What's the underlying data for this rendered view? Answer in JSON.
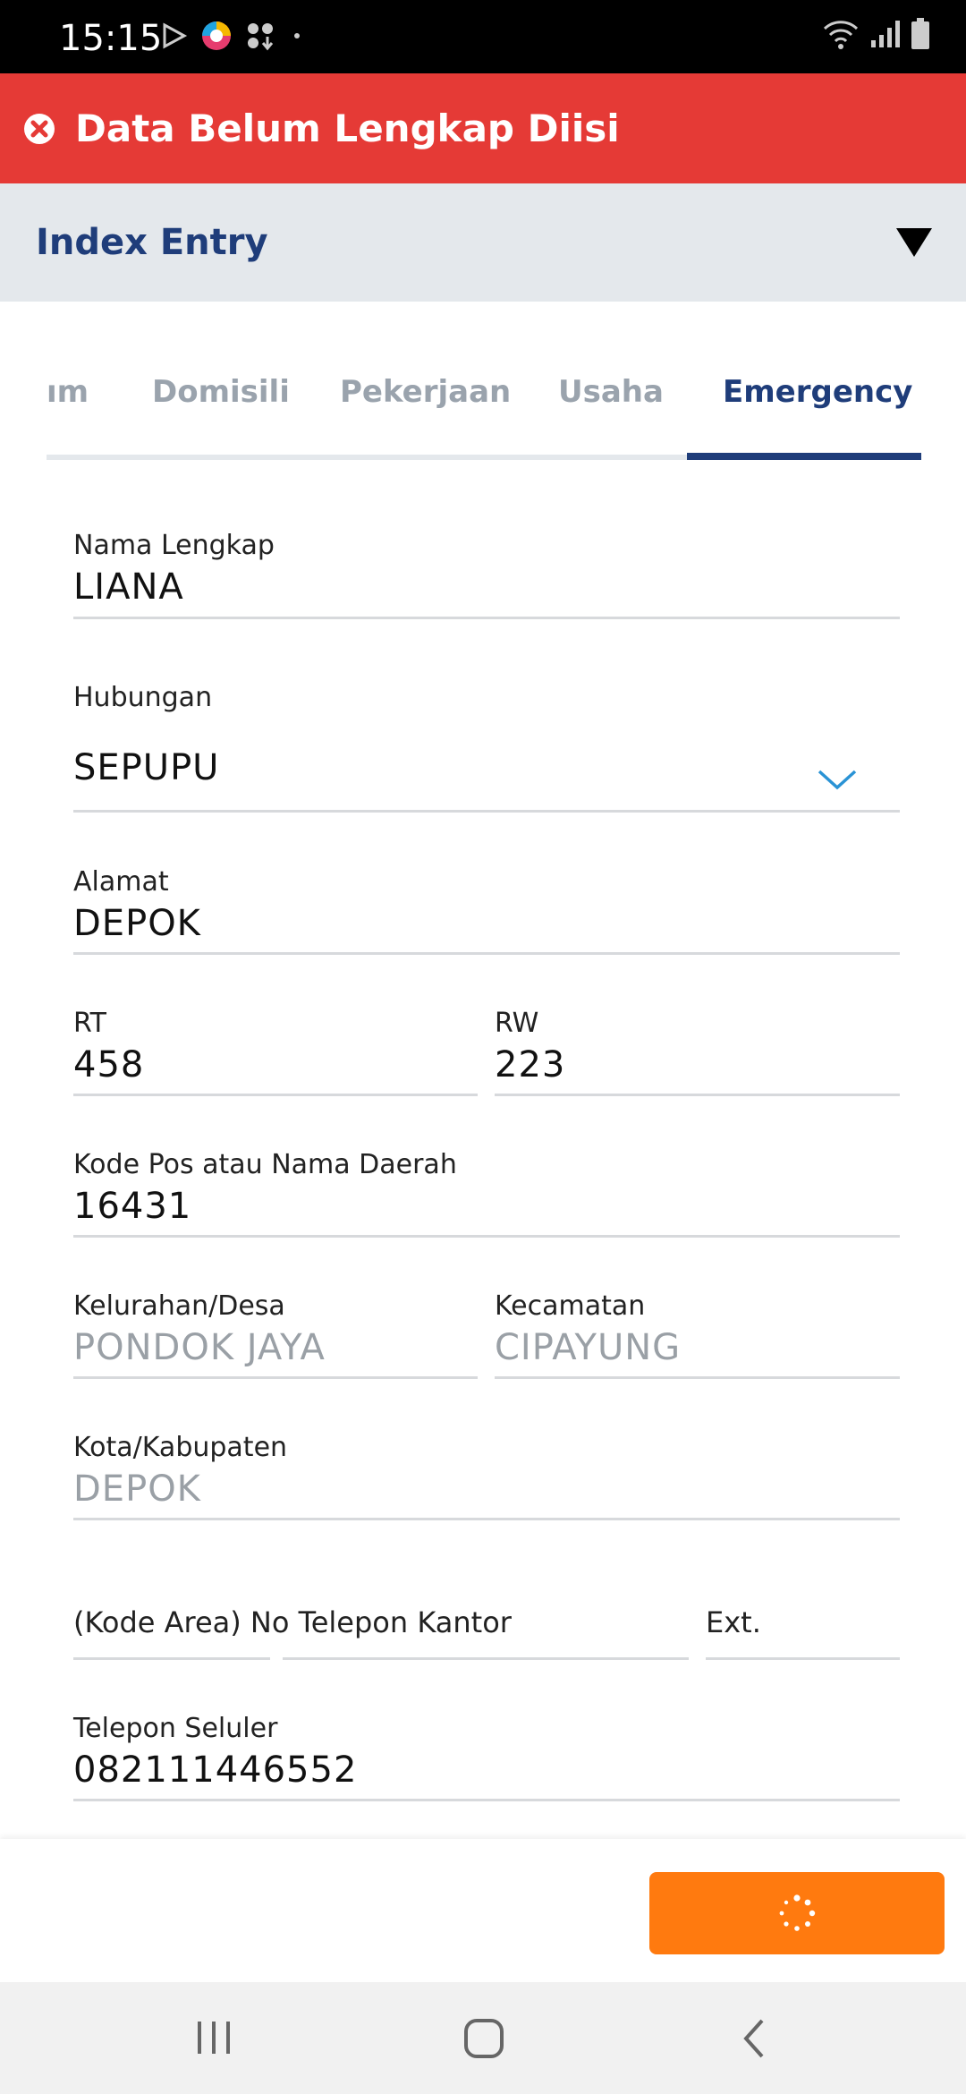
{
  "status_bar": {
    "time": "15:15",
    "left_icons": [
      "play-store-icon",
      "app-icon",
      "download-icon",
      "dot-icon"
    ],
    "right_icons": [
      "wifi-icon",
      "signal-icon",
      "battery-icon"
    ]
  },
  "error_banner": {
    "icon": "close-circle-icon",
    "text": "Data Belum Lengkap Diisi",
    "color": "#e53a36"
  },
  "section": {
    "title": "Index Entry",
    "toggle_icon": "caret-down-icon"
  },
  "tabs": [
    {
      "label": "ım"
    },
    {
      "label": "Domisili"
    },
    {
      "label": "Pekerjaan"
    },
    {
      "label": "Usaha"
    },
    {
      "label": "Emergency",
      "active": true
    }
  ],
  "form": {
    "nama_lengkap": {
      "label": "Nama Lengkap",
      "value": "LIANA"
    },
    "hubungan": {
      "label": "Hubungan",
      "value": "SEPUPU"
    },
    "alamat": {
      "label": "Alamat",
      "value": "DEPOK"
    },
    "rt": {
      "label": "RT",
      "value": "458"
    },
    "rw": {
      "label": "RW",
      "value": "223"
    },
    "kode_pos": {
      "label": "Kode Pos atau Nama Daerah",
      "value": "16431"
    },
    "kelurahan": {
      "label": "Kelurahan/Desa",
      "value": "PONDOK JAYA"
    },
    "kecamatan": {
      "label": "Kecamatan",
      "value": "CIPAYUNG"
    },
    "kota": {
      "label": "Kota/Kabupaten",
      "value": "DEPOK"
    },
    "telepon_kantor": {
      "label": "(Kode Area) No Telepon Kantor",
      "value": ""
    },
    "ext": {
      "label": "Ext.",
      "value": ""
    },
    "telepon_seluler": {
      "label": "Telepon Seluler",
      "value": "082111446552"
    }
  },
  "submit_button": {
    "icon": "loading-spinner-icon",
    "color": "#ff7a0f"
  },
  "nav_bar": {
    "icons": [
      "recent-apps-icon",
      "home-icon",
      "back-icon"
    ]
  }
}
